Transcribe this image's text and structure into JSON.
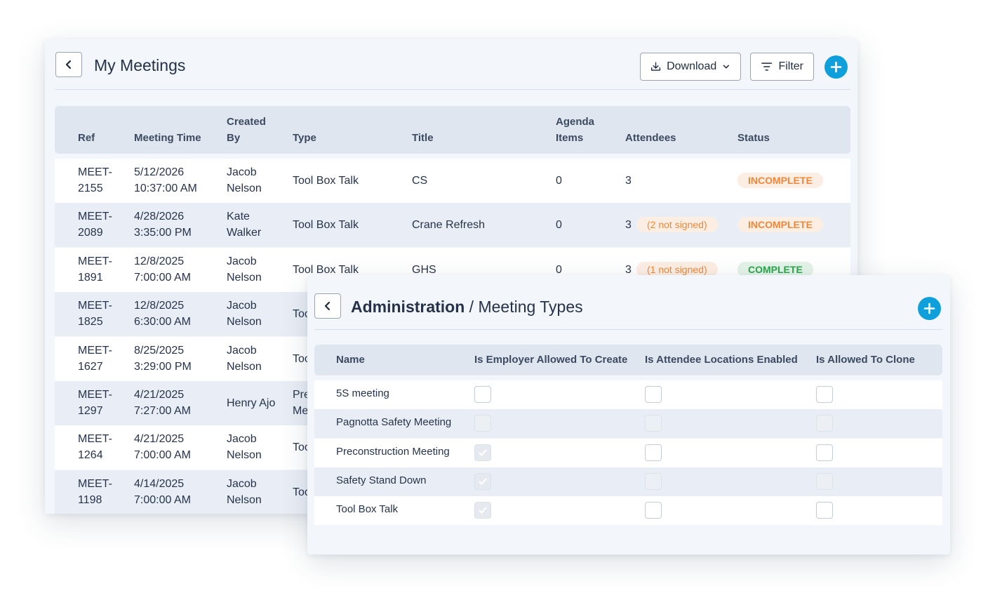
{
  "meetings": {
    "title": "My Meetings",
    "download_label": "Download",
    "filter_label": "Filter",
    "columns": {
      "ref": "Ref",
      "meeting_time": "Meeting Time",
      "created_by": "Created By",
      "type": "Type",
      "title": "Title",
      "agenda_items": "Agenda Items",
      "attendees": "Attendees",
      "status": "Status"
    },
    "rows": [
      {
        "ref": "MEET-2155",
        "date": "5/12/2026",
        "time": "10:37:00 AM",
        "created_by": "Jacob Nelson",
        "type": "Tool Box Talk",
        "title": "CS",
        "agenda": "0",
        "attendees": "3",
        "not_signed": "",
        "status": "INCOMPLETE"
      },
      {
        "ref": "MEET-2089",
        "date": "4/28/2026",
        "time": "3:35:00 PM",
        "created_by": "Kate Walker",
        "type": "Tool Box Talk",
        "title": "Crane Refresh",
        "agenda": "0",
        "attendees": "3",
        "not_signed": "(2 not signed)",
        "status": "INCOMPLETE"
      },
      {
        "ref": "MEET-1891",
        "date": "12/8/2025",
        "time": "7:00:00 AM",
        "created_by": "Jacob Nelson",
        "type": "Tool Box Talk",
        "title": "GHS",
        "agenda": "0",
        "attendees": "3",
        "not_signed": "(1 not signed)",
        "status": "COMPLETE"
      },
      {
        "ref": "MEET-1825",
        "date": "12/8/2025",
        "time": "6:30:00 AM",
        "created_by": "Jacob Nelson",
        "type": "Too",
        "title": "",
        "agenda": "",
        "attendees": "",
        "not_signed": "",
        "status": ""
      },
      {
        "ref": "MEET-1627",
        "date": "8/25/2025",
        "time": "3:29:00 PM",
        "created_by": "Jacob Nelson",
        "type": "Too",
        "title": "",
        "agenda": "",
        "attendees": "",
        "not_signed": "",
        "status": ""
      },
      {
        "ref": "MEET-1297",
        "date": "4/21/2025",
        "time": "7:27:00 AM",
        "created_by": "Henry Ajo",
        "type": "Pre Me",
        "title": "",
        "agenda": "",
        "attendees": "",
        "not_signed": "",
        "status": ""
      },
      {
        "ref": "MEET-1264",
        "date": "4/21/2025",
        "time": "7:00:00 AM",
        "created_by": "Jacob Nelson",
        "type": "Too",
        "title": "",
        "agenda": "",
        "attendees": "",
        "not_signed": "",
        "status": ""
      },
      {
        "ref": "MEET-1198",
        "date": "4/14/2025",
        "time": "7:00:00 AM",
        "created_by": "Jacob Nelson",
        "type": "Too",
        "title": "",
        "agenda": "",
        "attendees": "",
        "not_signed": "",
        "status": ""
      }
    ]
  },
  "meeting_types": {
    "breadcrumb_parent": "Administration",
    "breadcrumb_separator": "/",
    "breadcrumb_current": "Meeting Types",
    "columns": {
      "name": "Name",
      "employer": "Is Employer Allowed To Create",
      "locations": "Is Attendee Locations Enabled",
      "clone": "Is Allowed To Clone"
    },
    "rows": [
      {
        "name": "5S meeting",
        "employer": false,
        "locations": false,
        "clone": false,
        "disabled": false
      },
      {
        "name": "Pagnotta Safety Meeting",
        "employer": false,
        "locations": false,
        "clone": false,
        "disabled": true
      },
      {
        "name": "Preconstruction Meeting",
        "employer": true,
        "locations": false,
        "clone": false,
        "disabled": false
      },
      {
        "name": "Safety Stand Down",
        "employer": true,
        "locations": false,
        "clone": false,
        "disabled": true
      },
      {
        "name": "Tool Box Talk",
        "employer": true,
        "locations": false,
        "clone": false,
        "disabled": false
      }
    ]
  },
  "colors": {
    "accent": "#0fa0dc",
    "incomplete": "#f0883b",
    "complete": "#2aa54a"
  }
}
